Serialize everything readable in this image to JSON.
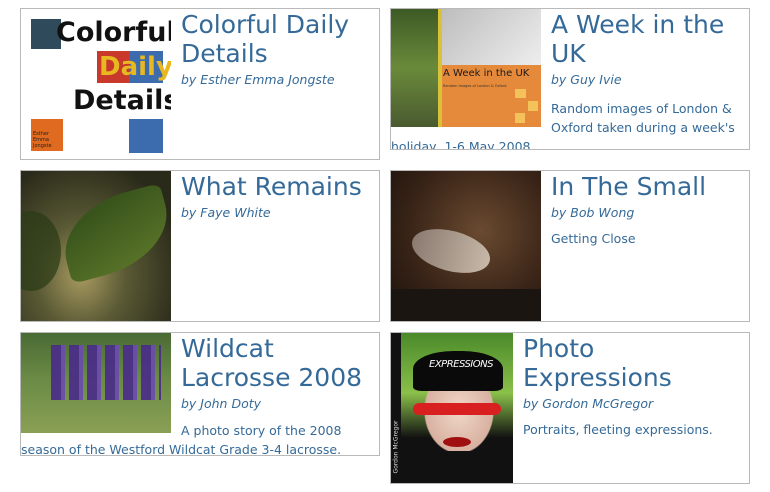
{
  "books": [
    {
      "title": "Colorful Daily Details",
      "author": "by Esther Emma Jongste",
      "description": "",
      "cover": {
        "line1": "Colorful",
        "line2": "Daily",
        "line3": "Details",
        "small1": "Esther",
        "small2": "Emma",
        "small3": "Jongste"
      }
    },
    {
      "title": "A Week in the UK",
      "author": "by Guy Ivie",
      "description": "Random images of London & Oxford taken during a week's holiday, 1-6 May 2008.",
      "cover": {
        "title": "A Week in the UK",
        "subtitle": "Random images of London & Oxford"
      }
    },
    {
      "title": "What Remains",
      "author": "by Faye White",
      "description": ""
    },
    {
      "title": "In The Small",
      "author": "by Bob Wong",
      "description": "Getting Close"
    },
    {
      "title": "Wildcat Lacrosse 2008",
      "author": "by John Doty",
      "description": "A photo story of the 2008 season of the Westford Wildcat Grade 3-4 lacrosse."
    },
    {
      "title": "Photo Expressions",
      "author": "by Gordon McGregor",
      "description": "Portraits, fleeting expressions.",
      "cover": {
        "title": "EXPRESSIONS",
        "spine": "Gordon McGregor"
      }
    }
  ],
  "colors": {
    "link": "#356a98",
    "border": "#b9b9b9"
  }
}
